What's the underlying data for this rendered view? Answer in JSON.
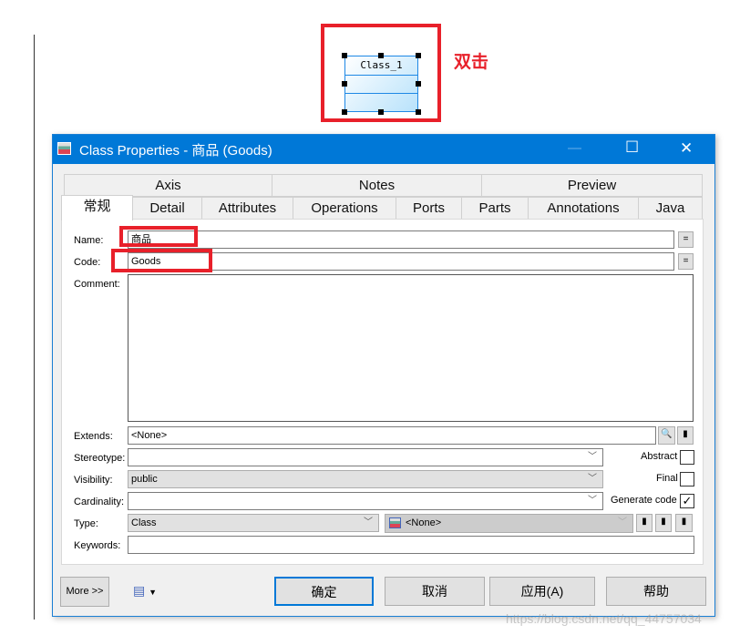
{
  "canvas": {
    "class_name": "Class_1",
    "annotation": "双击"
  },
  "window": {
    "title": "Class Properties - 商品 (Goods)",
    "minimize": "—",
    "maximize": "☐",
    "close": "✕"
  },
  "tabs": {
    "row1": [
      "Axis",
      "Notes",
      "Preview"
    ],
    "row2": [
      "常规",
      "Detail",
      "Attributes",
      "Operations",
      "Ports",
      "Parts",
      "Annotations",
      "Java"
    ],
    "active": "常规"
  },
  "form": {
    "name_label": "Name:",
    "name_value": "商品",
    "code_label": "Code:",
    "code_value": "Goods",
    "comment_label": "Comment:",
    "comment_value": "",
    "extends_label": "Extends:",
    "extends_value": "<None>",
    "stereotype_label": "Stereotype:",
    "stereotype_value": "",
    "visibility_label": "Visibility:",
    "visibility_value": "public",
    "cardinality_label": "Cardinality:",
    "cardinality_value": "",
    "type_label": "Type:",
    "type_value": "Class",
    "type_target": "<None>",
    "keywords_label": "Keywords:",
    "keywords_value": "",
    "abstract_label": "Abstract",
    "abstract_checked": false,
    "final_label": "Final",
    "final_checked": false,
    "generate_label": "Generate code",
    "generate_checked": true,
    "equals": "="
  },
  "buttons": {
    "more": "More >>",
    "ok": "确定",
    "cancel": "取消",
    "apply": "应用(A)",
    "help": "帮助"
  },
  "watermark": "https://blog.csdn.net/qq_44757034",
  "colors": {
    "accent": "#0078d7",
    "highlight": "#e8202a"
  }
}
